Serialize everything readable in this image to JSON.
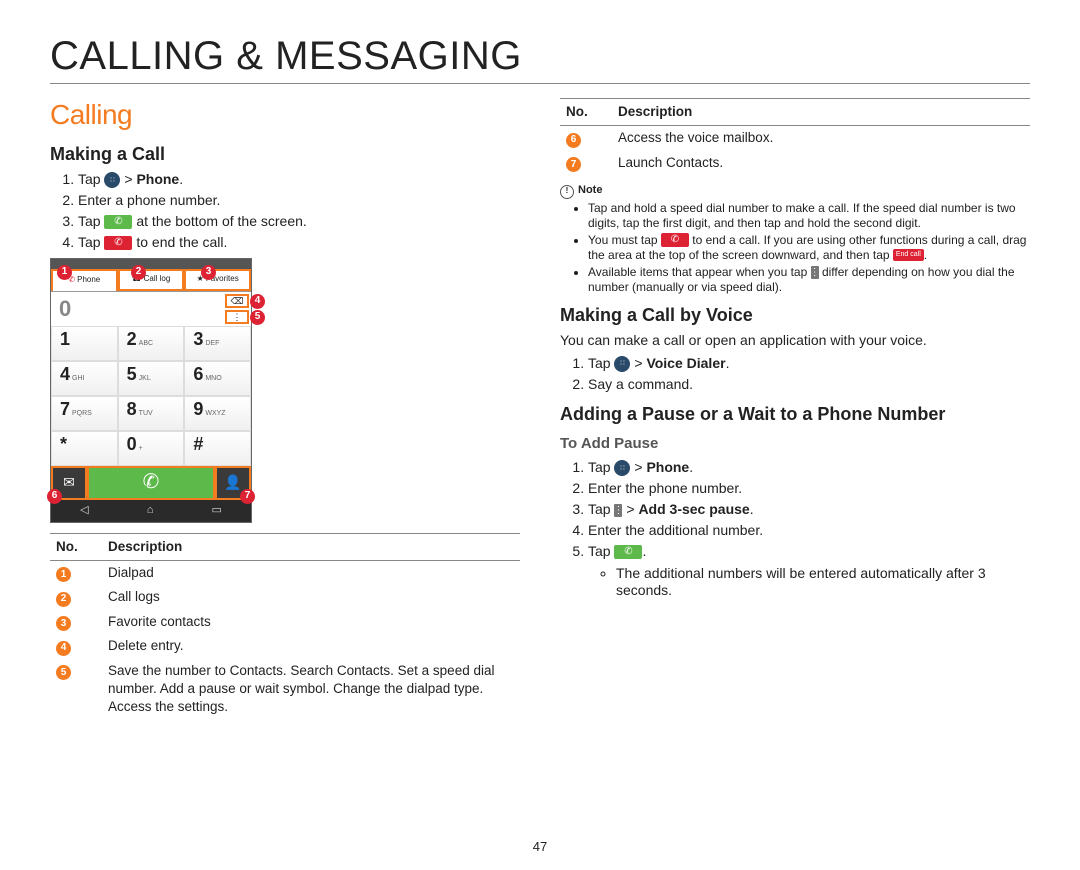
{
  "page": {
    "title": "CALLING & MESSAGING",
    "section": "Calling",
    "number": "47"
  },
  "left": {
    "making_a_call": "Making a Call",
    "steps": {
      "s1a": "Tap ",
      "s1b": " > ",
      "s1c": "Phone",
      "s1d": ".",
      "s2": "Enter a phone number.",
      "s3a": "Tap ",
      "s3b": " at the bottom of the screen.",
      "s4a": "Tap ",
      "s4b": " to end the call."
    },
    "phone": {
      "tabs": {
        "phone": "Phone",
        "calllog": "Call log",
        "favorites": "Favorites"
      },
      "display": "0",
      "keys": [
        {
          "main": "1",
          "sub": ""
        },
        {
          "main": "2",
          "sub": "ABC"
        },
        {
          "main": "3",
          "sub": "DEF"
        },
        {
          "main": "4",
          "sub": "GHI"
        },
        {
          "main": "5",
          "sub": "JKL"
        },
        {
          "main": "6",
          "sub": "MNO"
        },
        {
          "main": "7",
          "sub": "PQRS"
        },
        {
          "main": "8",
          "sub": "TUV"
        },
        {
          "main": "9",
          "sub": "WXYZ"
        },
        {
          "main": "*",
          "sub": ""
        },
        {
          "main": "0",
          "sub": "+"
        },
        {
          "main": "#",
          "sub": ""
        }
      ]
    },
    "table": {
      "head_no": "No.",
      "head_desc": "Description",
      "rows": [
        {
          "n": "1",
          "d": "Dialpad"
        },
        {
          "n": "2",
          "d": "Call logs"
        },
        {
          "n": "3",
          "d": "Favorite contacts"
        },
        {
          "n": "4",
          "d": "Delete entry."
        },
        {
          "n": "5",
          "d": "Save the number to Contacts. Search Contacts. Set a speed dial number. Add a pause or wait symbol. Change the dialpad type. Access the settings."
        }
      ]
    }
  },
  "right": {
    "table": {
      "head_no": "No.",
      "head_desc": "Description",
      "rows": [
        {
          "n": "6",
          "d": "Access the voice mailbox."
        },
        {
          "n": "7",
          "d": "Launch Contacts."
        }
      ]
    },
    "note_label": "Note",
    "notes": {
      "n1": "Tap and hold a speed dial number to make a call. If the speed dial number is two digits, tap the first digit, and then tap and hold the second digit.",
      "n2a": "You must tap ",
      "n2b": " to end a call. If you are using other functions during a call, drag the area at the top of the screen downward, and then tap ",
      "n2c": ".",
      "n2_endlabel": "End call",
      "n3a": "Available items that appear when you tap ",
      "n3b": " differ depending on how you dial the number (manually or via speed dial)."
    },
    "voice": {
      "heading": "Making a Call by Voice",
      "intro": "You can make a call or open an application with your voice.",
      "s1a": "Tap ",
      "s1b": " > ",
      "s1c": "Voice Dialer",
      "s1d": ".",
      "s2": "Say a command."
    },
    "pause": {
      "heading": "Adding a Pause or a Wait to a Phone Number",
      "sub": "To Add Pause",
      "s1a": "Tap ",
      "s1b": " > ",
      "s1c": "Phone",
      "s1d": ".",
      "s2": "Enter the phone number.",
      "s3a": "Tap ",
      "s3b": " > ",
      "s3c": "Add 3-sec pause",
      "s3d": ".",
      "s4": "Enter the additional number.",
      "s5a": "Tap ",
      "s5b": ".",
      "bullet": "The additional numbers will be entered automatically after 3 seconds."
    }
  }
}
